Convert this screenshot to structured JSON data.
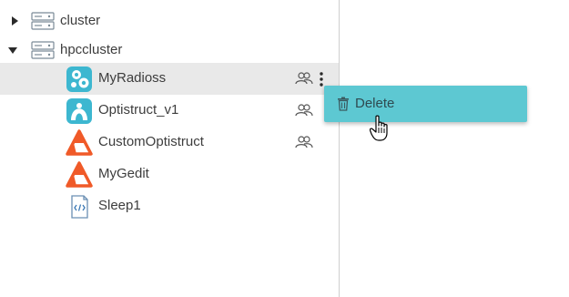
{
  "tree": {
    "clusters": [
      {
        "label": "cluster",
        "expanded": false,
        "icon": "server-icon"
      },
      {
        "label": "hpccluster",
        "expanded": true,
        "icon": "server-icon"
      }
    ],
    "apps": [
      {
        "label": "MyRadioss",
        "icon": "radioss-icon",
        "shared": true,
        "selected": true
      },
      {
        "label": "Optistruct_v1",
        "icon": "optistruct-icon",
        "shared": true
      },
      {
        "label": "CustomOptistruct",
        "icon": "altair-logo-icon",
        "shared": true
      },
      {
        "label": "MyGedit",
        "icon": "altair-logo-icon",
        "shared": false
      },
      {
        "label": "Sleep1",
        "icon": "code-file-icon",
        "shared": false
      }
    ]
  },
  "context_menu": {
    "items": [
      {
        "label": "Delete",
        "icon": "trash-icon"
      }
    ],
    "background": "#5dc8d2"
  },
  "colors": {
    "selected_row": "#e9e9e9",
    "altair_orange": "#f05a28",
    "radioss_teal": "#3db7d0"
  }
}
